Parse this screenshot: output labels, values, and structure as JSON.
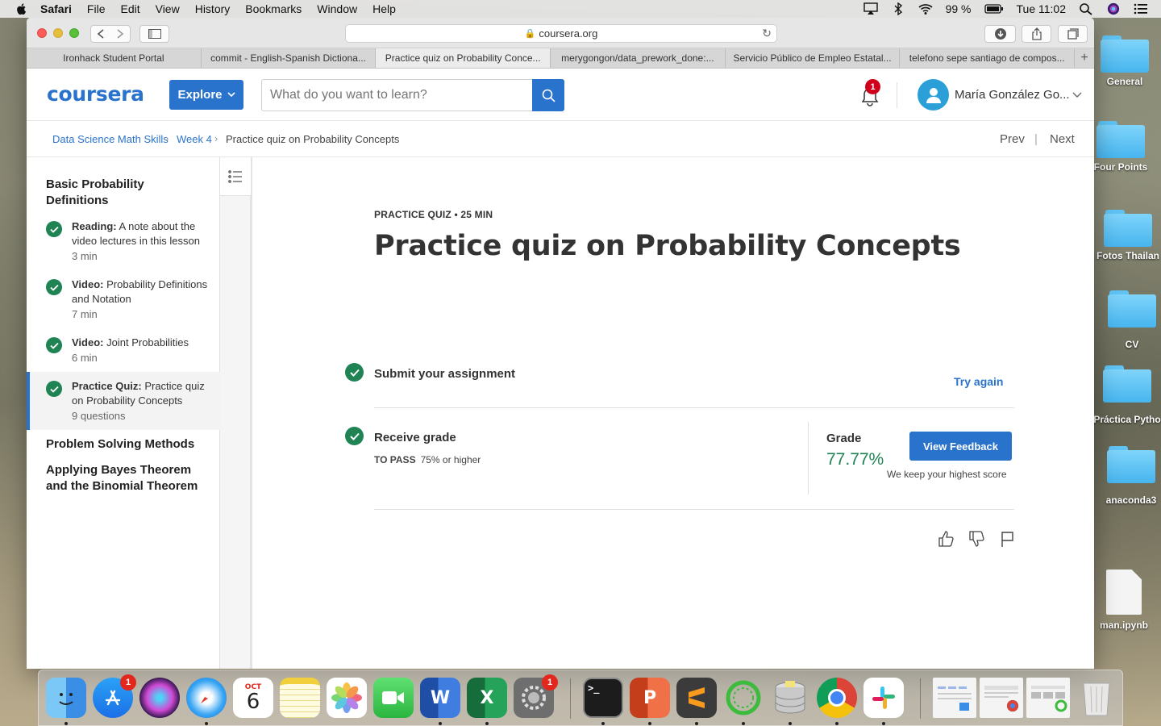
{
  "menubar": {
    "app_name": "Safari",
    "items": [
      "File",
      "Edit",
      "View",
      "History",
      "Bookmarks",
      "Window",
      "Help"
    ],
    "battery": "99 %",
    "clock": "Tue 11:02"
  },
  "browser": {
    "url": "coursera.org",
    "tabs": [
      "Ironhack Student Portal",
      "commit - English-Spanish Dictiona...",
      "Practice quiz on Probability Conce...",
      "merygongon/data_prework_done:...",
      "Servicio Público de Empleo Estatal...",
      "telefono sepe santiago de compos..."
    ],
    "active_tab_index": 2,
    "new_tab_label": "+"
  },
  "header": {
    "logo": "coursera",
    "explore_label": "Explore",
    "search_placeholder": "What do you want to learn?",
    "notification_count": "1",
    "user_name": "María González Go..."
  },
  "breadcrumb": {
    "items": [
      "Data Science Math Skills",
      "Week 4",
      "Practice quiz on Probability Concepts"
    ],
    "prev": "Prev",
    "separator": "|",
    "next": "Next"
  },
  "sidebar": {
    "section_1": "Basic Probability Definitions",
    "items": [
      {
        "type": "Reading:",
        "title": "A note about the video lectures in this lesson",
        "meta": "3 min"
      },
      {
        "type": "Video:",
        "title": "Probability Definitions and Notation",
        "meta": "7 min"
      },
      {
        "type": "Video:",
        "title": "Joint Probabilities",
        "meta": "6 min"
      },
      {
        "type": "Practice Quiz:",
        "title": "Practice quiz on Probability Concepts",
        "meta": "9 questions"
      }
    ],
    "section_2": "Problem Solving Methods",
    "section_3": "Applying Bayes Theorem and the Binomial Theorem"
  },
  "quiz": {
    "kicker": "PRACTICE QUIZ • 25 MIN",
    "title": "Practice quiz on Probability Concepts",
    "submit_label": "Submit your assignment",
    "try_again": "Try again",
    "receive_grade": "Receive grade",
    "to_pass_label": "TO PASS",
    "to_pass_value": "75% or higher",
    "grade_label": "Grade",
    "grade_value": "77.77%",
    "view_feedback": "View Feedback",
    "keep_score": "We keep your highest score"
  },
  "desktop_icons": [
    "General",
    "Four Points",
    "Fotos Thailan",
    "CV",
    "Práctica Pytho",
    "anaconda3",
    "man.ipynb"
  ],
  "dock": {
    "calendar_month": "OCT",
    "calendar_day": "6",
    "app_store_badge": "1",
    "prefs_badge": "1",
    "word_letter": "W",
    "excel_letter": "X",
    "ppt_letter": "P",
    "terminal_prompt": ">_"
  },
  "colors": {
    "coursera_blue": "#2a73cc",
    "success_green": "#1f8354",
    "badge_red": "#d0021b"
  }
}
